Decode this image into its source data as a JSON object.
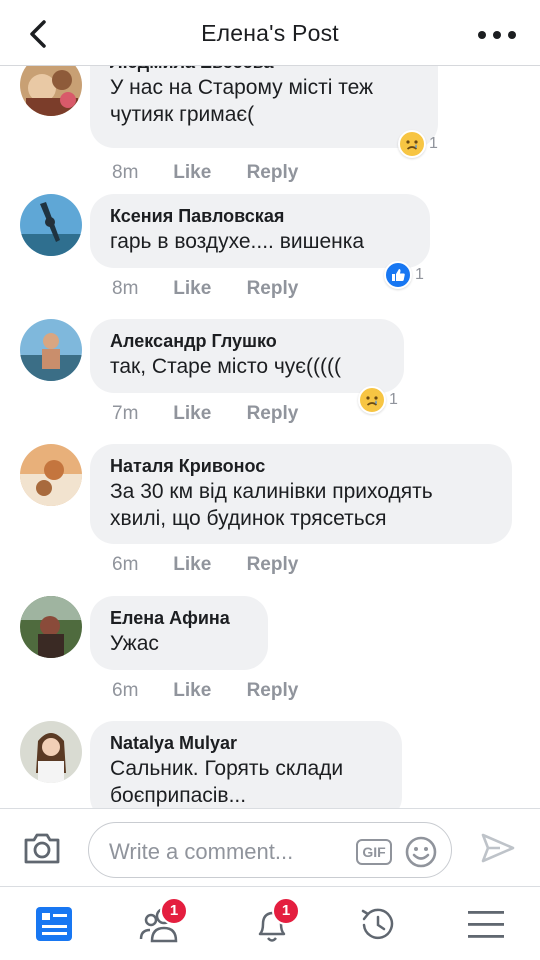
{
  "header": {
    "title": "Елена's Post"
  },
  "comments": [
    {
      "author": "Людмила Евсеева",
      "text": "У нас на Старому місті теж\nчутияк гримає(",
      "time": "8m",
      "reaction": {
        "type": "sad",
        "count": "1"
      }
    },
    {
      "author": "Ксения Павловская",
      "text": "гарь в воздухе.... вишенка",
      "time": "8m",
      "reaction": {
        "type": "like",
        "count": "1"
      }
    },
    {
      "author": "Александр Глушко",
      "text": "так, Старе місто чує(((((",
      "time": "7m",
      "reaction": {
        "type": "sad",
        "count": "1"
      }
    },
    {
      "author": "Наталя Кривонос",
      "text": "За 30 км від калинівки приходять\nхвилі, що будинок трясеться",
      "time": "6m"
    },
    {
      "author": "Елена Афина",
      "text": "Ужас",
      "time": "6m"
    },
    {
      "author": "Natalya Mulyar",
      "text": "Сальник. Горять склади\nбоєприпасів..."
    }
  ],
  "actions": {
    "like": "Like",
    "reply": "Reply"
  },
  "composer": {
    "placeholder": "Write a comment...",
    "gif_label": "GIF"
  },
  "tabbar": {
    "friends_badge": "1",
    "notifications_badge": "1"
  },
  "colors": {
    "accent": "#1877f2",
    "badge": "#e41e3f",
    "bubble": "#f0f1f3",
    "meta": "#90949c"
  }
}
